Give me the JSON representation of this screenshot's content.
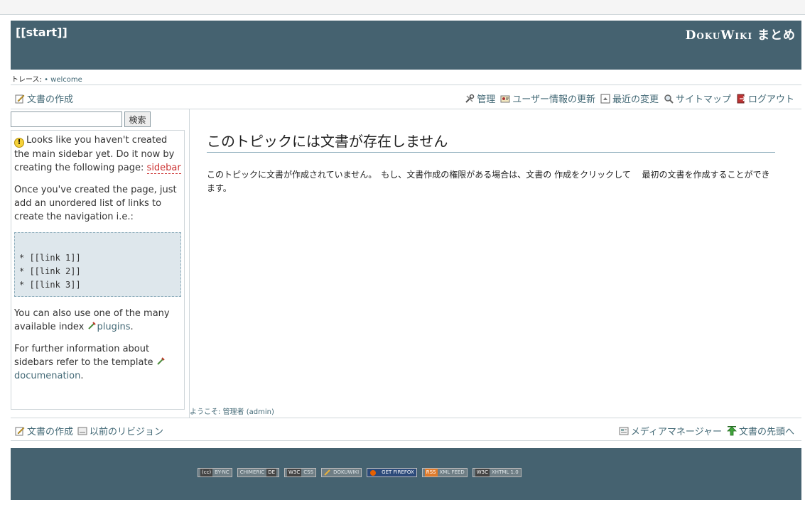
{
  "header": {
    "page_title": "[[start]]",
    "wiki_title": "DokuWiki まとめ"
  },
  "trace": {
    "label": "トレース:",
    "bullet": "•",
    "link": "welcome"
  },
  "top_bar": {
    "create_page": "文書の作成",
    "admin": "管理",
    "profile": "ユーザー情報の更新",
    "recent": "最近の変更",
    "sitemap": "サイトマップ",
    "logout": "ログアウト"
  },
  "search": {
    "value": "",
    "button": "検索"
  },
  "sidebar": {
    "notice": "Looks like you haven't created the main sidebar yet. Do it now by creating the following page:",
    "sidebar_link": "sidebar",
    "para2": "Once you've created the page, just add an unordered list of links to create the navigation i.e.:",
    "code_lines": [
      "* [[link 1]]",
      "* [[link 2]]",
      "* [[link 3]]"
    ],
    "para3_pre": "You can also use one of the many available index",
    "plugins_link": "plugins",
    "para3_post": ".",
    "para4_pre": "For further information about sidebars refer to the template",
    "doc_link": "documenation",
    "para4_post": "."
  },
  "content": {
    "heading": "このトピックには文書が存在しません",
    "body": "このトピックに文書が作成されていません。　もし、文書作成の権限がある場合は、文書の 作成をクリックして　 最初の文書を作成することができます。"
  },
  "welcome": {
    "label": "ようこそ:",
    "name": "管理者",
    "user": "(admin)"
  },
  "bottom_bar": {
    "create_page": "文書の作成",
    "old_revisions": "以前のリビジョン",
    "media_manager": "メディアマネージャー",
    "back_to_top": "文書の先頭へ"
  },
  "footer": {
    "badges": [
      {
        "a": "(cc)",
        "b": "BY-NC"
      },
      {
        "a": "CHIMERIC",
        "b": "DE"
      },
      {
        "a": "W3C",
        "b": "CSS"
      },
      {
        "a": "",
        "b": "DOKUWIKI"
      },
      {
        "a": "",
        "b": "GET FIREFOX"
      },
      {
        "a": "RSS",
        "b": "XML FEED"
      },
      {
        "a": "W3C",
        "b": "XHTML 1.0"
      }
    ]
  },
  "colors": {
    "header_bg": "#456270",
    "link": "#436976",
    "redlink": "#cc3333"
  }
}
